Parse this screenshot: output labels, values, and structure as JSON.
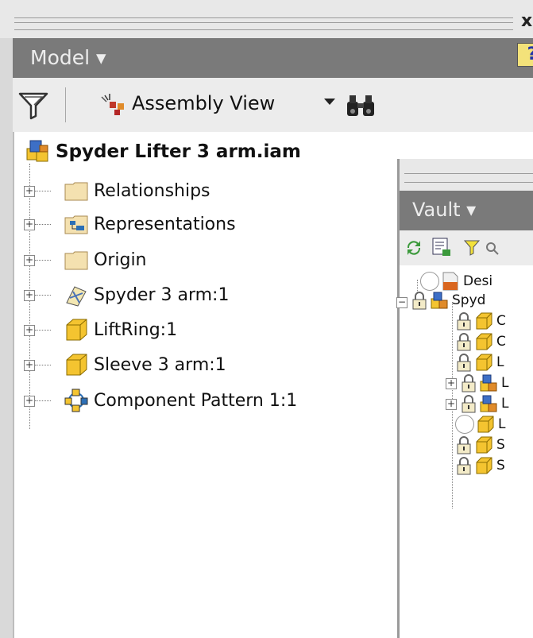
{
  "window": {
    "close_glyph": "x"
  },
  "model_panel": {
    "title": "Model ▾",
    "help_glyph": "?",
    "toolbar": {
      "view_label": "Assembly View"
    },
    "tree": {
      "root": "Spyder Lifter 3 arm.iam",
      "items": [
        {
          "label": "Relationships",
          "icon": "folder-icon"
        },
        {
          "label": "Representations",
          "icon": "representations-icon"
        },
        {
          "label": "Origin",
          "icon": "folder-icon"
        },
        {
          "label": "Spyder 3 arm:1",
          "icon": "weldment-part-icon"
        },
        {
          "label": "LiftRing:1",
          "icon": "part-icon"
        },
        {
          "label": "Sleeve 3 arm:1",
          "icon": "part-icon"
        },
        {
          "label": "Component Pattern 1:1",
          "icon": "pattern-icon"
        }
      ]
    }
  },
  "vault_panel": {
    "title": "Vault ▾",
    "tree": {
      "items": [
        {
          "label": "Desi",
          "icon": "design-project-icon",
          "lock": false
        },
        {
          "label": "Spyd",
          "icon": "assembly-icon",
          "lock": true
        },
        {
          "label": "C",
          "icon": "part-icon",
          "lock": true
        },
        {
          "label": "C",
          "icon": "part-icon",
          "lock": true
        },
        {
          "label": "L",
          "icon": "part-icon",
          "lock": true
        },
        {
          "label": "L",
          "icon": "assembly-icon",
          "lock": true
        },
        {
          "label": "L",
          "icon": "assembly-icon",
          "lock": true
        },
        {
          "label": "L",
          "icon": "part-icon",
          "lock": false
        },
        {
          "label": "S",
          "icon": "part-icon",
          "lock": true
        },
        {
          "label": "S",
          "icon": "part-icon",
          "lock": true
        }
      ]
    }
  }
}
